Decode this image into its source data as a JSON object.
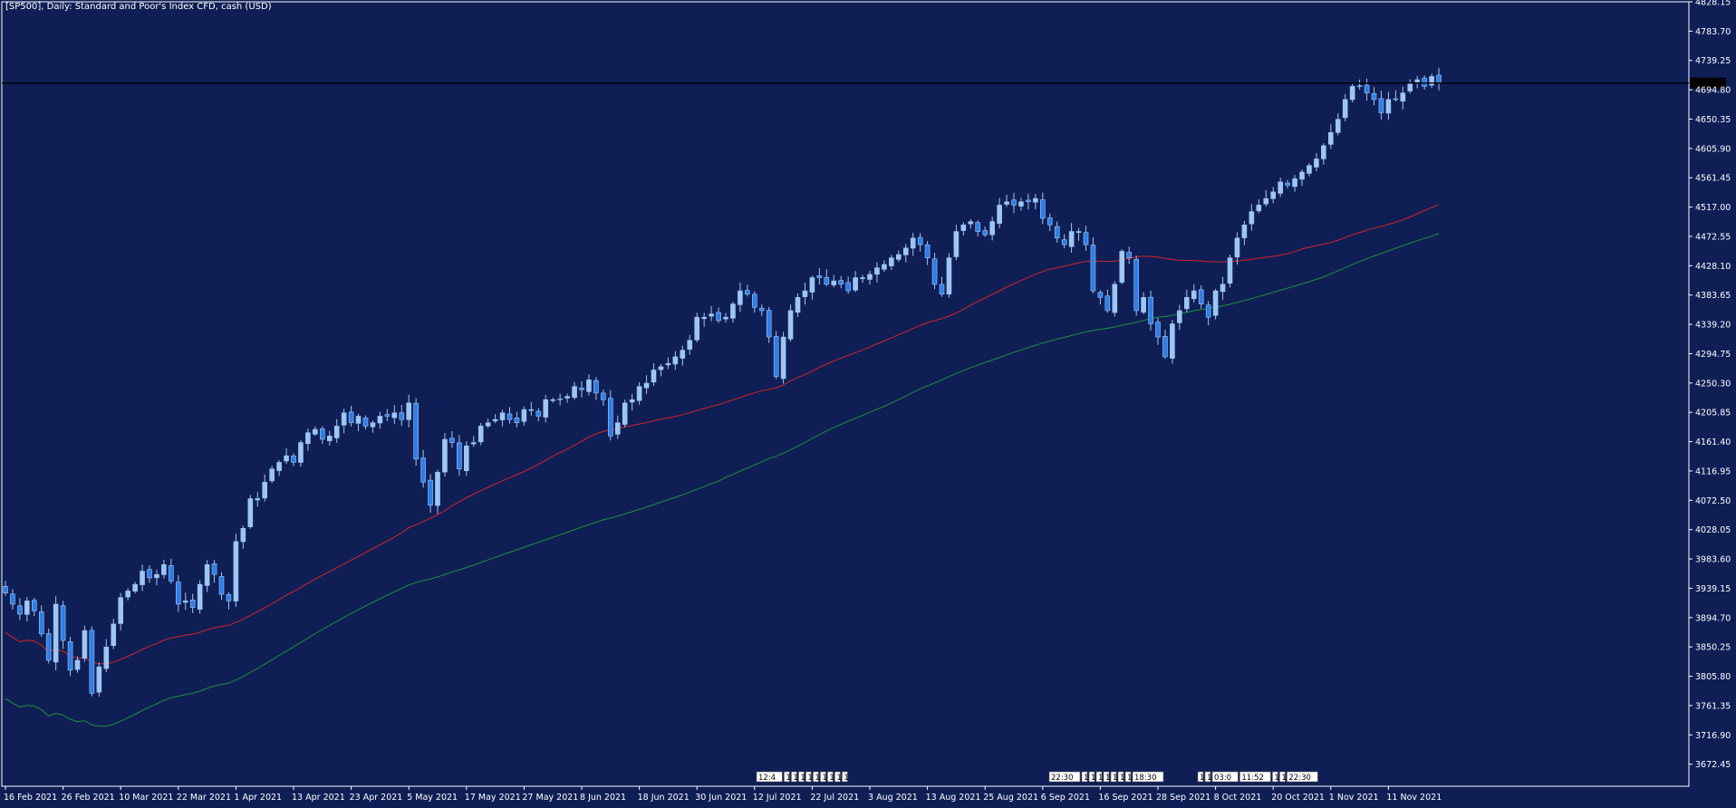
{
  "window": {
    "title": "[SP500], Daily:  Standard and Poor's Index CFD, cash (USD)"
  },
  "colors": {
    "background": "#0f1f55",
    "grid_frame": "#ffffff",
    "text": "#ffffff",
    "candle_up": "#9ec6f5",
    "candle_down": "#2e7ee8",
    "ma_short": "#d2222a",
    "ma_long": "#1f8f3a",
    "price_line": "#000000",
    "price_label_bg": "#000000"
  },
  "chart_data": {
    "type": "candlestick",
    "symbol": "SP500",
    "timeframe": "Daily",
    "ylim": [
      3650,
      4828.15
    ],
    "y_ticks": [
      "4828.15",
      "4783.70",
      "4739.25",
      "4694.80",
      "4650.35",
      "4605.90",
      "4561.45",
      "4517.00",
      "4472.55",
      "4428.10",
      "4383.65",
      "4339.20",
      "4294.75",
      "4250.30",
      "4205.85",
      "4161.40",
      "4116.95",
      "4072.50",
      "4028.05",
      "3983.60",
      "3939.15",
      "3894.70",
      "3850.25",
      "3805.80",
      "3761.35",
      "3716.90",
      "3672.45"
    ],
    "x_labels": [
      "16 Feb 2021",
      "26 Feb 2021",
      "10 Mar 2021",
      "22 Mar 2021",
      "1 Apr 2021",
      "13 Apr 2021",
      "23 Apr 2021",
      "5 May 2021",
      "17 May 2021",
      "27 May 2021",
      "8 Jun 2021",
      "18 Jun 2021",
      "30 Jun 2021",
      "12 Jul 2021",
      "22 Jul 2021",
      "3 Aug 2021",
      "13 Aug 2021",
      "25 Aug 2021",
      "6 Sep 2021",
      "16 Sep 2021",
      "28 Sep 2021",
      "8 Oct 2021",
      "20 Oct 2021",
      "1 Nov 2021",
      "11 Nov 2021"
    ],
    "x_label_index": [
      0,
      8,
      16,
      24,
      32,
      40,
      48,
      56,
      64,
      72,
      80,
      88,
      96,
      104,
      112,
      120,
      128,
      136,
      144,
      152,
      160,
      168,
      176,
      184,
      192
    ],
    "current_price": 4705.0,
    "closes": [
      3932,
      3915,
      3900,
      3920,
      3905,
      3870,
      3830,
      3915,
      3860,
      3815,
      3830,
      3875,
      3780,
      3820,
      3850,
      3885,
      3925,
      3935,
      3945,
      3965,
      3955,
      3960,
      3975,
      3950,
      3915,
      3920,
      3910,
      3945,
      3975,
      3960,
      3930,
      3920,
      4010,
      4030,
      4075,
      4075,
      4100,
      4120,
      4130,
      4140,
      4130,
      4160,
      4175,
      4180,
      4165,
      4170,
      4185,
      4205,
      4190,
      4200,
      4185,
      4190,
      4200,
      4200,
      4205,
      4195,
      4220,
      4135,
      4100,
      4065,
      4115,
      4165,
      4160,
      4120,
      4155,
      4160,
      4185,
      4190,
      4195,
      4205,
      4195,
      4190,
      4210,
      4210,
      4200,
      4225,
      4225,
      4225,
      4230,
      4245,
      4240,
      4255,
      4235,
      4225,
      4170,
      4190,
      4220,
      4225,
      4245,
      4250,
      4270,
      4275,
      4280,
      4290,
      4300,
      4315,
      4350,
      4350,
      4355,
      4345,
      4350,
      4370,
      4390,
      4385,
      4365,
      4360,
      4320,
      4260,
      4320,
      4360,
      4380,
      4390,
      4410,
      4410,
      4400,
      4405,
      4400,
      4390,
      4410,
      4410,
      4415,
      4425,
      4430,
      4440,
      4445,
      4455,
      4470,
      4460,
      4440,
      4400,
      4385,
      4440,
      4480,
      4490,
      4495,
      4480,
      4475,
      4495,
      4520,
      4525,
      4520,
      4525,
      4525,
      4530,
      4500,
      4490,
      4470,
      4460,
      4480,
      4480,
      4460,
      4390,
      4380,
      4360,
      4400,
      4450,
      4440,
      4360,
      4380,
      4340,
      4320,
      4290,
      4340,
      4360,
      4380,
      4390,
      4370,
      4350,
      4390,
      4400,
      4440,
      4470,
      4490,
      4510,
      4520,
      4530,
      4540,
      4555,
      4550,
      4560,
      4570,
      4580,
      4590,
      4610,
      4630,
      4650,
      4680,
      4700,
      4700,
      4690,
      4680,
      4660,
      4680,
      4680,
      4690,
      4705,
      4710,
      4700,
      4715,
      4705
    ],
    "series": [
      {
        "name": "",
        "type": "line",
        "period": 50,
        "color_key": "ma_short"
      },
      {
        "name": "",
        "type": "line",
        "period": 100,
        "color_key": "ma_long"
      }
    ],
    "grid": false
  },
  "news_markers": [
    "12:4",
    "1",
    "1",
    "1",
    "1",
    "1",
    "1",
    "1",
    "1",
    "1",
    "22:30",
    "1",
    "1",
    "13",
    "1",
    "1",
    "1",
    "1",
    "18:30",
    "1",
    "1",
    "03:0",
    "11:52",
    "1",
    "1",
    "22:30"
  ]
}
